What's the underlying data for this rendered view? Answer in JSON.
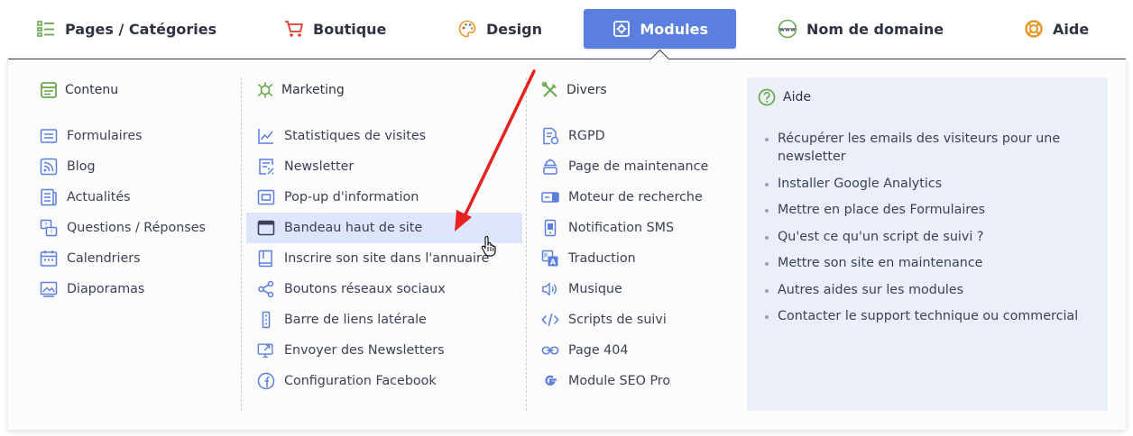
{
  "topnav": {
    "items": [
      {
        "label": "Pages / Catégories",
        "icon": "list-icon"
      },
      {
        "label": "Boutique",
        "icon": "cart-icon"
      },
      {
        "label": "Design",
        "icon": "palette-icon"
      },
      {
        "label": "Modules",
        "icon": "gear-icon",
        "active": true
      },
      {
        "label": "Nom de domaine",
        "icon": "www-icon"
      },
      {
        "label": "Aide",
        "icon": "lifebuoy-icon"
      }
    ]
  },
  "columns": {
    "contenu": {
      "title": "Contenu",
      "items": [
        {
          "label": "Formulaires",
          "icon": "form-icon"
        },
        {
          "label": "Blog",
          "icon": "rss-icon"
        },
        {
          "label": "Actualités",
          "icon": "news-icon"
        },
        {
          "label": "Questions / Réponses",
          "icon": "faq-icon"
        },
        {
          "label": "Calendriers",
          "icon": "calendar-icon"
        },
        {
          "label": "Diaporamas",
          "icon": "slideshow-icon"
        }
      ]
    },
    "marketing": {
      "title": "Marketing",
      "items": [
        {
          "label": "Statistiques de visites",
          "icon": "chart-icon"
        },
        {
          "label": "Newsletter",
          "icon": "newsletter-icon"
        },
        {
          "label": "Pop-up d'information",
          "icon": "popup-icon"
        },
        {
          "label": "Bandeau haut de site",
          "icon": "banner-icon",
          "highlight": true
        },
        {
          "label": "Inscrire son site dans l'annuaire",
          "icon": "directory-icon"
        },
        {
          "label": "Boutons réseaux sociaux",
          "icon": "share-icon"
        },
        {
          "label": "Barre de liens latérale",
          "icon": "sidebar-icon"
        },
        {
          "label": "Envoyer des Newsletters",
          "icon": "send-icon"
        },
        {
          "label": "Configuration Facebook",
          "icon": "facebook-icon"
        }
      ]
    },
    "divers": {
      "title": "Divers",
      "items": [
        {
          "label": "RGPD",
          "icon": "gdpr-icon"
        },
        {
          "label": "Page de maintenance",
          "icon": "maintenance-icon"
        },
        {
          "label": "Moteur de recherche",
          "icon": "search-bar-icon"
        },
        {
          "label": "Notification SMS",
          "icon": "phone-icon"
        },
        {
          "label": "Traduction",
          "icon": "translate-icon"
        },
        {
          "label": "Musique",
          "icon": "speaker-icon"
        },
        {
          "label": "Scripts de suivi",
          "icon": "code-icon"
        },
        {
          "label": "Page 404",
          "icon": "broken-link-icon"
        },
        {
          "label": "Module SEO Pro",
          "icon": "google-icon"
        }
      ]
    }
  },
  "help": {
    "title": "Aide",
    "links": [
      "Récupérer les emails des visiteurs pour une newsletter",
      "Installer Google Analytics",
      "Mettre en place des Formulaires",
      "Qu'est ce qu'un script de suivi ?",
      "Mettre son site en maintenance",
      "Autres aides sur les modules",
      "Contacter le support technique ou commercial"
    ]
  },
  "colors": {
    "accent": "#5b7fde",
    "highlight": "#dde6fb",
    "help_bg": "#eaeff9",
    "icon_blue": "#5b7fde",
    "icon_green": "#6aa84f",
    "arrow": "#e8201f"
  }
}
